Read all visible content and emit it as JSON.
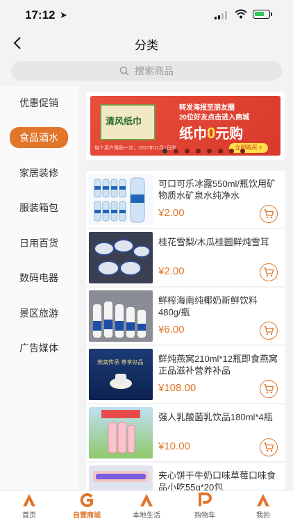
{
  "status": {
    "time": "17:12"
  },
  "nav": {
    "title": "分类"
  },
  "search": {
    "placeholder": "搜索商品"
  },
  "sidebar": {
    "items": [
      {
        "label": "优惠促销",
        "active": false
      },
      {
        "label": "食品酒水",
        "active": true
      },
      {
        "label": "家居装修",
        "active": false
      },
      {
        "label": "服装箱包",
        "active": false
      },
      {
        "label": "日用百货",
        "active": false
      },
      {
        "label": "数码电器",
        "active": false
      },
      {
        "label": "景区旅游",
        "active": false
      },
      {
        "label": "广告媒体",
        "active": false
      }
    ]
  },
  "banner": {
    "box_text": "清风纸巾",
    "line1": "转发海报至朋友圈",
    "line2": "20位好友点击进入商城",
    "headline_pre": "纸巾",
    "headline_zero": "0",
    "headline_post": "元购",
    "note": "每个用户限购一次，2022年11月1日前…",
    "button": "立即购买 >"
  },
  "products": [
    {
      "name": "可口可乐冰露550ml/瓶饮用矿物质水矿泉水纯净水",
      "price": "¥2.00",
      "thumb": "water"
    },
    {
      "name": "桂花雪梨/木瓜桂圆鲜炖雪耳",
      "price": "¥2.00",
      "thumb": "cups"
    },
    {
      "name": "鲜榨海南纯椰奶新鲜饮料480g/瓶",
      "price": "¥6.00",
      "thumb": "coconut"
    },
    {
      "name": "鲜炖燕窝210ml*12瓶即食燕窝正品滋补营养补品",
      "price": "¥108.00",
      "thumb": "nest"
    },
    {
      "name": "强人乳酸菌乳饮品180ml*4瓶",
      "price": "¥10.00",
      "thumb": "yogurt"
    },
    {
      "name": "夹心饼干牛奶口味草莓口味食品小吃55g*20包",
      "price": "",
      "thumb": "biscuit"
    }
  ],
  "tabbar": {
    "items": [
      {
        "label": "首页",
        "active": false
      },
      {
        "label": "自营商城",
        "active": true
      },
      {
        "label": "本地生活",
        "active": false
      },
      {
        "label": "购物车",
        "active": false
      },
      {
        "label": "我的",
        "active": false
      }
    ]
  },
  "colors": {
    "accent": "#e1762b",
    "banner_red": "#e94e3c",
    "background": "#f3f3f3"
  }
}
